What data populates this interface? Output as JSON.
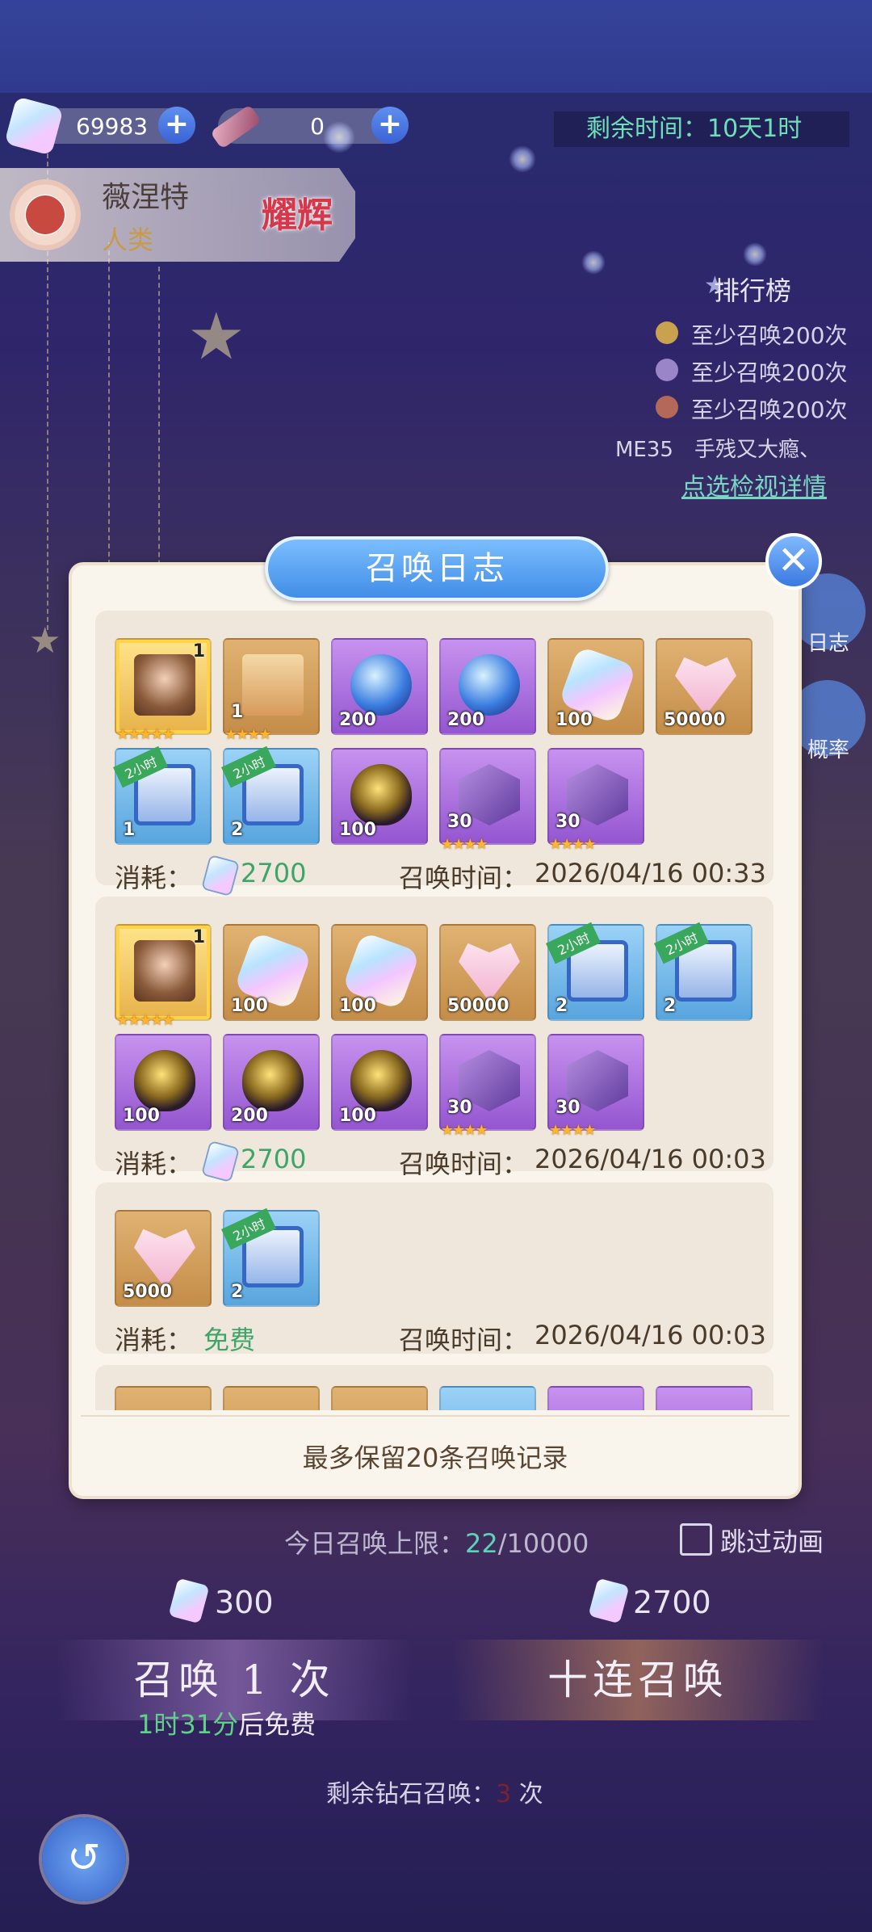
{
  "resources": {
    "diamonds": "69983",
    "tickets": "0",
    "time_left_label": "剩余时间：10天1时"
  },
  "character": {
    "name": "薇涅特",
    "race": "人类",
    "rank": "耀辉"
  },
  "leaderboard": {
    "title": "排行榜",
    "items": [
      "至少召唤200次",
      "至少召唤200次",
      "至少召唤200次"
    ],
    "note": "ME35　手残又大瘾、",
    "link": "点选检视详情"
  },
  "side_buttons": [
    "日志",
    "概率"
  ],
  "modal": {
    "title": "召唤日志",
    "cost_label": "消耗：",
    "time_label": "召唤时间：",
    "footer": "最多保留20条召唤记录",
    "entries": [
      {
        "cost": "2700",
        "time": "2026/04/16 00:33",
        "items": [
          {
            "icon": "character-portrait",
            "count": "1",
            "stars": "★★★★★"
          },
          {
            "icon": "mystery-box",
            "count": "1",
            "stars": "★★★★"
          },
          {
            "icon": "crystal-orb",
            "count": "200"
          },
          {
            "icon": "crystal-orb",
            "count": "200"
          },
          {
            "icon": "diamond-gem",
            "count": "100"
          },
          {
            "icon": "exp-heart",
            "count": "50000"
          },
          {
            "icon": "treasure-chest",
            "count": "1",
            "tag": "2小时"
          },
          {
            "icon": "treasure-chest",
            "count": "2",
            "tag": "2小时"
          },
          {
            "icon": "golden-egg",
            "count": "100"
          },
          {
            "icon": "purple-crystal",
            "count": "30",
            "stars": "★★★★"
          },
          {
            "icon": "purple-crystal",
            "count": "30",
            "stars": "★★★★"
          }
        ]
      },
      {
        "cost": "2700",
        "time": "2026/04/16 00:03",
        "items": [
          {
            "icon": "character-portrait",
            "count": "1",
            "stars": "★★★★★"
          },
          {
            "icon": "diamond-gem",
            "count": "100"
          },
          {
            "icon": "diamond-gem",
            "count": "100"
          },
          {
            "icon": "exp-heart",
            "count": "50000"
          },
          {
            "icon": "treasure-chest",
            "count": "2",
            "tag": "2小时"
          },
          {
            "icon": "treasure-chest",
            "count": "2",
            "tag": "2小时"
          },
          {
            "icon": "golden-egg",
            "count": "100"
          },
          {
            "icon": "golden-egg",
            "count": "200"
          },
          {
            "icon": "golden-egg",
            "count": "100"
          },
          {
            "icon": "purple-crystal",
            "count": "30",
            "stars": "★★★★"
          },
          {
            "icon": "purple-crystal",
            "count": "30",
            "stars": "★★★★"
          }
        ]
      },
      {
        "cost": "免费",
        "time": "2026/04/16 00:03",
        "items": [
          {
            "icon": "exp-heart",
            "count": "5000"
          },
          {
            "icon": "treasure-chest",
            "count": "2",
            "tag": "2小时"
          }
        ]
      }
    ]
  },
  "bottom": {
    "daily_label": "今日召唤上限：",
    "daily_used": "22",
    "daily_max": "/10000",
    "skip_label": "跳过动画",
    "single_price": "300",
    "ten_price": "2700",
    "single_label": "召唤 1 次",
    "ten_label": "十连召唤",
    "free_timer": "1时31分",
    "free_suffix": "后免费",
    "remain_prefix": "剩余钻石召唤：",
    "remain_count": "3",
    "remain_suffix": " 次"
  }
}
